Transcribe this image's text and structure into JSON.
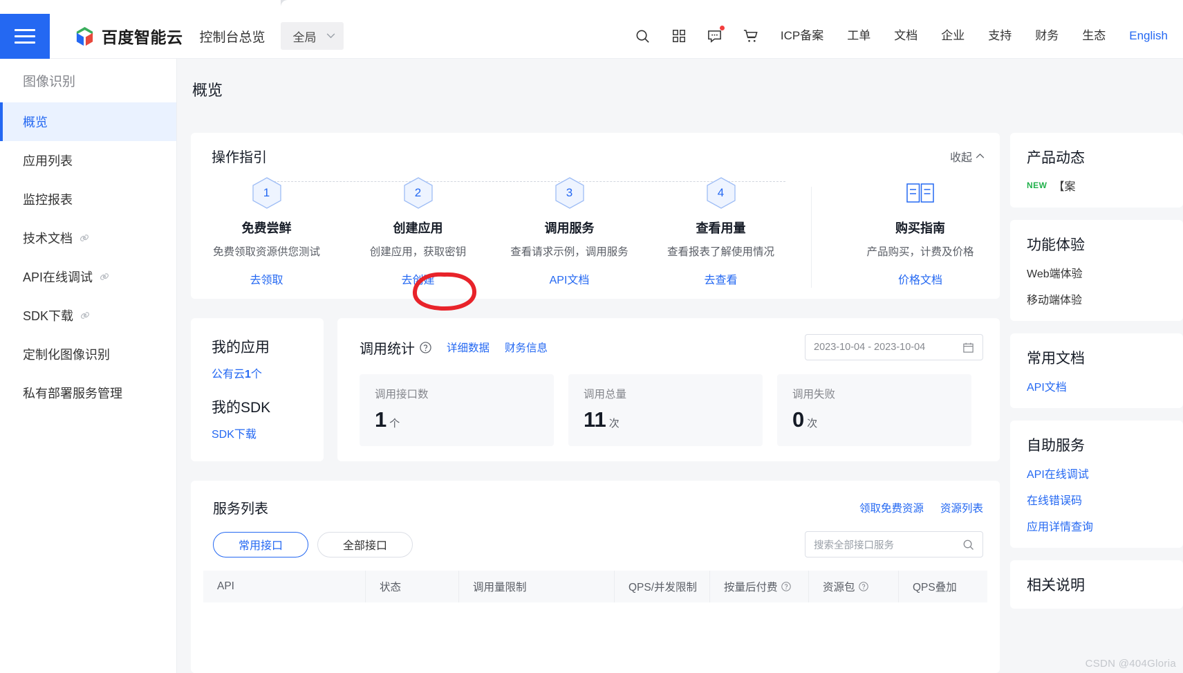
{
  "header": {
    "menu_icon": "hamburger-icon",
    "brand_name": "百度智能云",
    "console_title": "控制台总览",
    "region": "全局",
    "icons": [
      "search-icon",
      "apps-grid-icon",
      "message-icon",
      "cart-icon"
    ],
    "nav_items": [
      "ICP备案",
      "工单",
      "文档",
      "企业",
      "支持",
      "财务",
      "生态"
    ],
    "language": "English",
    "accent_color": "#2468f2",
    "badge_color": "#f33e3e"
  },
  "sidebar": {
    "header": "图像识别",
    "items": [
      {
        "label": "概览",
        "active": true,
        "external": false
      },
      {
        "label": "应用列表",
        "active": false,
        "external": false
      },
      {
        "label": "监控报表",
        "active": false,
        "external": false
      },
      {
        "label": "技术文档",
        "active": false,
        "external": true
      },
      {
        "label": "API在线调试",
        "active": false,
        "external": true
      },
      {
        "label": "SDK下载",
        "active": false,
        "external": true
      },
      {
        "label": "定制化图像识别",
        "active": false,
        "external": false
      },
      {
        "label": "私有部署服务管理",
        "active": false,
        "external": false
      }
    ]
  },
  "page_title": "概览",
  "guide": {
    "title": "操作指引",
    "collapse_label": "收起",
    "steps": [
      {
        "num": "1",
        "title": "免费尝鲜",
        "desc": "免费领取资源供您测试",
        "link": "去领取"
      },
      {
        "num": "2",
        "title": "创建应用",
        "desc": "创建应用，获取密钥",
        "link": "去创建"
      },
      {
        "num": "3",
        "title": "调用服务",
        "desc": "查看请求示例，调用服务",
        "link": "API文档"
      },
      {
        "num": "4",
        "title": "查看用量",
        "desc": "查看报表了解使用情况",
        "link": "去查看"
      }
    ],
    "buy": {
      "icon": "book-icon",
      "title": "购买指南",
      "desc": "产品购买，计费及价格",
      "link": "价格文档"
    },
    "annotation": {
      "shape": "hand-drawn-circle",
      "color": "#e8232a",
      "target": "去创建"
    }
  },
  "my_app": {
    "title": "我的应用",
    "cloud_prefix": "公有云",
    "cloud_count": "1",
    "cloud_suffix": "个",
    "sdk_title": "我的SDK",
    "sdk_link": "SDK下载"
  },
  "stats": {
    "title": "调用统计",
    "help_icon": "question-circle-icon",
    "links": [
      "详细数据",
      "财务信息"
    ],
    "date_range": "2023-10-04 - 2023-10-04",
    "calendar_icon": "calendar-icon",
    "boxes": [
      {
        "label": "调用接口数",
        "value": "1",
        "unit": "个"
      },
      {
        "label": "调用总量",
        "value": "11",
        "unit": "次"
      },
      {
        "label": "调用失败",
        "value": "0",
        "unit": "次"
      }
    ]
  },
  "service_list": {
    "title": "服务列表",
    "right_links": [
      "领取免费资源",
      "资源列表"
    ],
    "tabs": [
      {
        "label": "常用接口",
        "active": true
      },
      {
        "label": "全部接口",
        "active": false
      }
    ],
    "search_placeholder": "搜索全部接口服务",
    "search_icon": "search-icon",
    "columns": [
      {
        "label": "API",
        "help": false
      },
      {
        "label": "状态",
        "help": false
      },
      {
        "label": "调用量限制",
        "help": false
      },
      {
        "label": "QPS/并发限制",
        "help": false
      },
      {
        "label": "按量后付费",
        "help": true
      },
      {
        "label": "资源包",
        "help": true
      },
      {
        "label": "QPS叠加",
        "help": false
      }
    ]
  },
  "right_column": {
    "cards": [
      {
        "title": "产品动态",
        "tag": "NEW",
        "rows": [
          "【案"
        ],
        "links": []
      },
      {
        "title": "功能体验",
        "rows": [
          "Web端体验",
          "移动端体验"
        ],
        "links": []
      },
      {
        "title": "常用文档",
        "rows": [],
        "links": [
          "API文档"
        ]
      },
      {
        "title": "自助服务",
        "rows": [],
        "links": [
          "API在线调试",
          "在线错误码",
          "应用详情查询"
        ]
      },
      {
        "title": "相关说明",
        "rows": [],
        "links": []
      }
    ]
  },
  "watermark": "CSDN @404Gloria"
}
